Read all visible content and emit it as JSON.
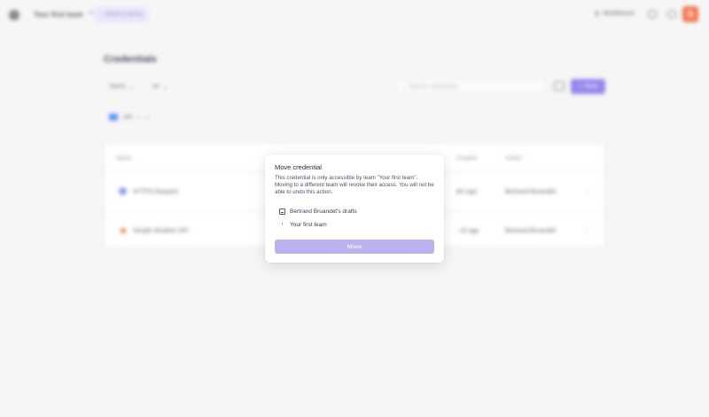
{
  "topbar": {
    "team_name": "Your first team",
    "book_demo_label": "Book a demo",
    "workbench_label": "Workbench",
    "avatar_letter": "S"
  },
  "page": {
    "title": "Credentials",
    "filter_name_label": "Name",
    "filter_all_label": "All",
    "search_placeholder": "Search credentials...",
    "new_button_label": "New",
    "folder_label": "API"
  },
  "table": {
    "columns": {
      "name": "Name",
      "created": "Created",
      "author": "Author"
    },
    "rows": [
      {
        "name": "HTTPS Request",
        "created": "8m ago",
        "author": "Bertrand Bruandet",
        "icon_color": "#7c83f0"
      },
      {
        "name": "Simple Weather API",
        "created": "~1h ago",
        "author": "Bertrand Bruandet",
        "icon_color": "#f27a3a"
      }
    ]
  },
  "modal": {
    "title": "Move credential",
    "description": "This credential is only accessible by team \"Your first team\". Moving to a different team will revoke their access. You will not be able to undo this action.",
    "tree": {
      "drafts_label": "Bertrand Bruandet's drafts",
      "team_label": "Your first team"
    },
    "move_button_label": "Move"
  },
  "colors": {
    "accent": "#7c6fe6",
    "disabled_button": "#bcb3ee",
    "avatar_brand": "#f05a2a"
  }
}
